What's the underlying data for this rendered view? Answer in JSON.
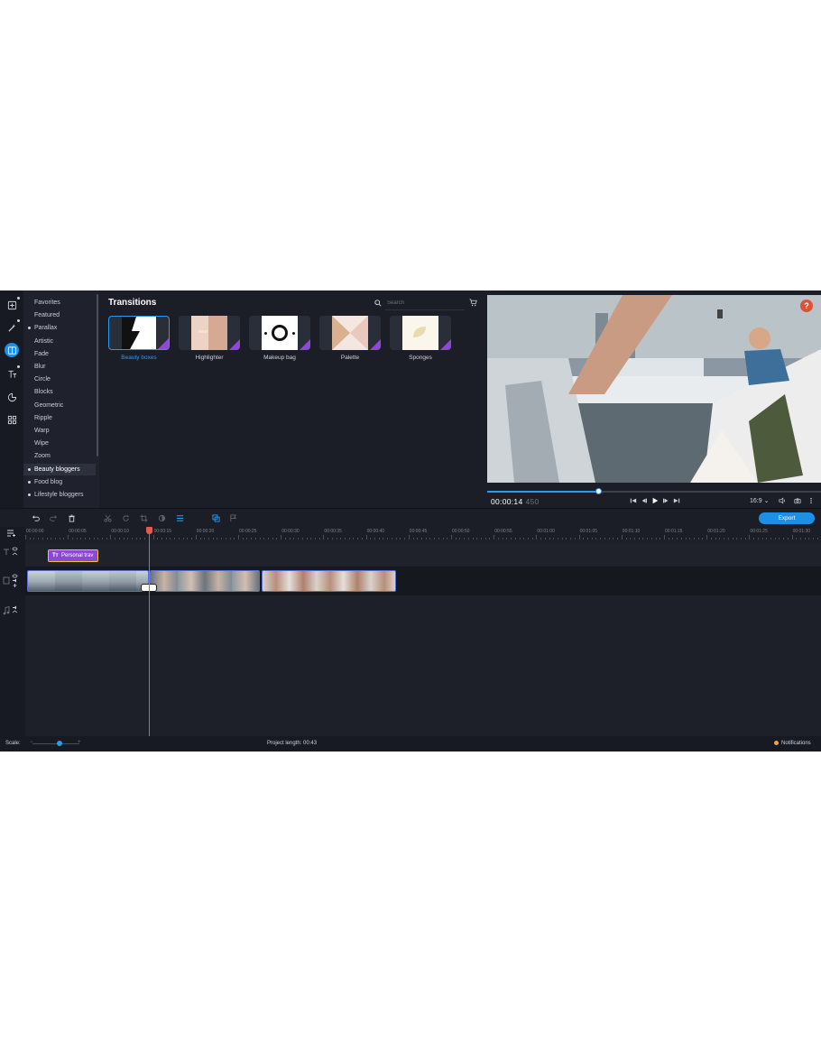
{
  "sidebar": {
    "categories": [
      {
        "label": "Favorites",
        "bullet": false
      },
      {
        "label": "Featured",
        "bullet": false
      },
      {
        "label": "Parallax",
        "bullet": true
      },
      {
        "label": "Artistic",
        "bullet": false
      },
      {
        "label": "Fade",
        "bullet": false
      },
      {
        "label": "Blur",
        "bullet": false
      },
      {
        "label": "Circle",
        "bullet": false
      },
      {
        "label": "Blocks",
        "bullet": false
      },
      {
        "label": "Geometric",
        "bullet": false
      },
      {
        "label": "Ripple",
        "bullet": false
      },
      {
        "label": "Warp",
        "bullet": false
      },
      {
        "label": "Wipe",
        "bullet": false
      },
      {
        "label": "Zoom",
        "bullet": false
      },
      {
        "label": "Beauty bloggers",
        "bullet": true,
        "selected": true
      },
      {
        "label": "Food blog",
        "bullet": true
      },
      {
        "label": "Lifestyle bloggers",
        "bullet": true
      }
    ],
    "tools": [
      "import-icon",
      "magic-wand-icon",
      "transitions-icon",
      "titles-icon",
      "stickers-icon",
      "more-tools-icon"
    ]
  },
  "transitions": {
    "title": "Transitions",
    "search_placeholder": "Search",
    "items": [
      {
        "label": "Beauty boxes",
        "selected": true
      },
      {
        "label": "Highlighter",
        "selected": false
      },
      {
        "label": "Makeup bag",
        "selected": false
      },
      {
        "label": "Palette",
        "selected": false
      },
      {
        "label": "Sponges",
        "selected": false
      }
    ]
  },
  "player": {
    "timecode": "00:00:14",
    "timecode_ms": "450",
    "progress": 0.335,
    "aspect_ratio": "16:9 ⌄",
    "help": "?"
  },
  "timeline": {
    "export_label": "Export",
    "ruler_ticks": [
      "00:00:00",
      "00:00:05",
      "00:00:10",
      "00:00:15",
      "00:00:20",
      "00:00:25",
      "00:00:30",
      "00:00:35",
      "00:00:40",
      "00:00:45",
      "00:00:50",
      "00:00:55",
      "00:01:00",
      "00:01:05",
      "00:01:10",
      "00:01:15",
      "00:01:20",
      "00:01:25",
      "00:01:30"
    ],
    "title_clip": "Personal trav",
    "title_clip_icon": "Tт"
  },
  "status": {
    "scale_label": "Scale:",
    "project_length": "Project length:  00:43",
    "notifications": "Notifications"
  },
  "colors": {
    "accent": "#1e8fe6",
    "pro_badge": "#8d48d6",
    "playhead": "#e25b4c",
    "background": "#1b1e27"
  }
}
